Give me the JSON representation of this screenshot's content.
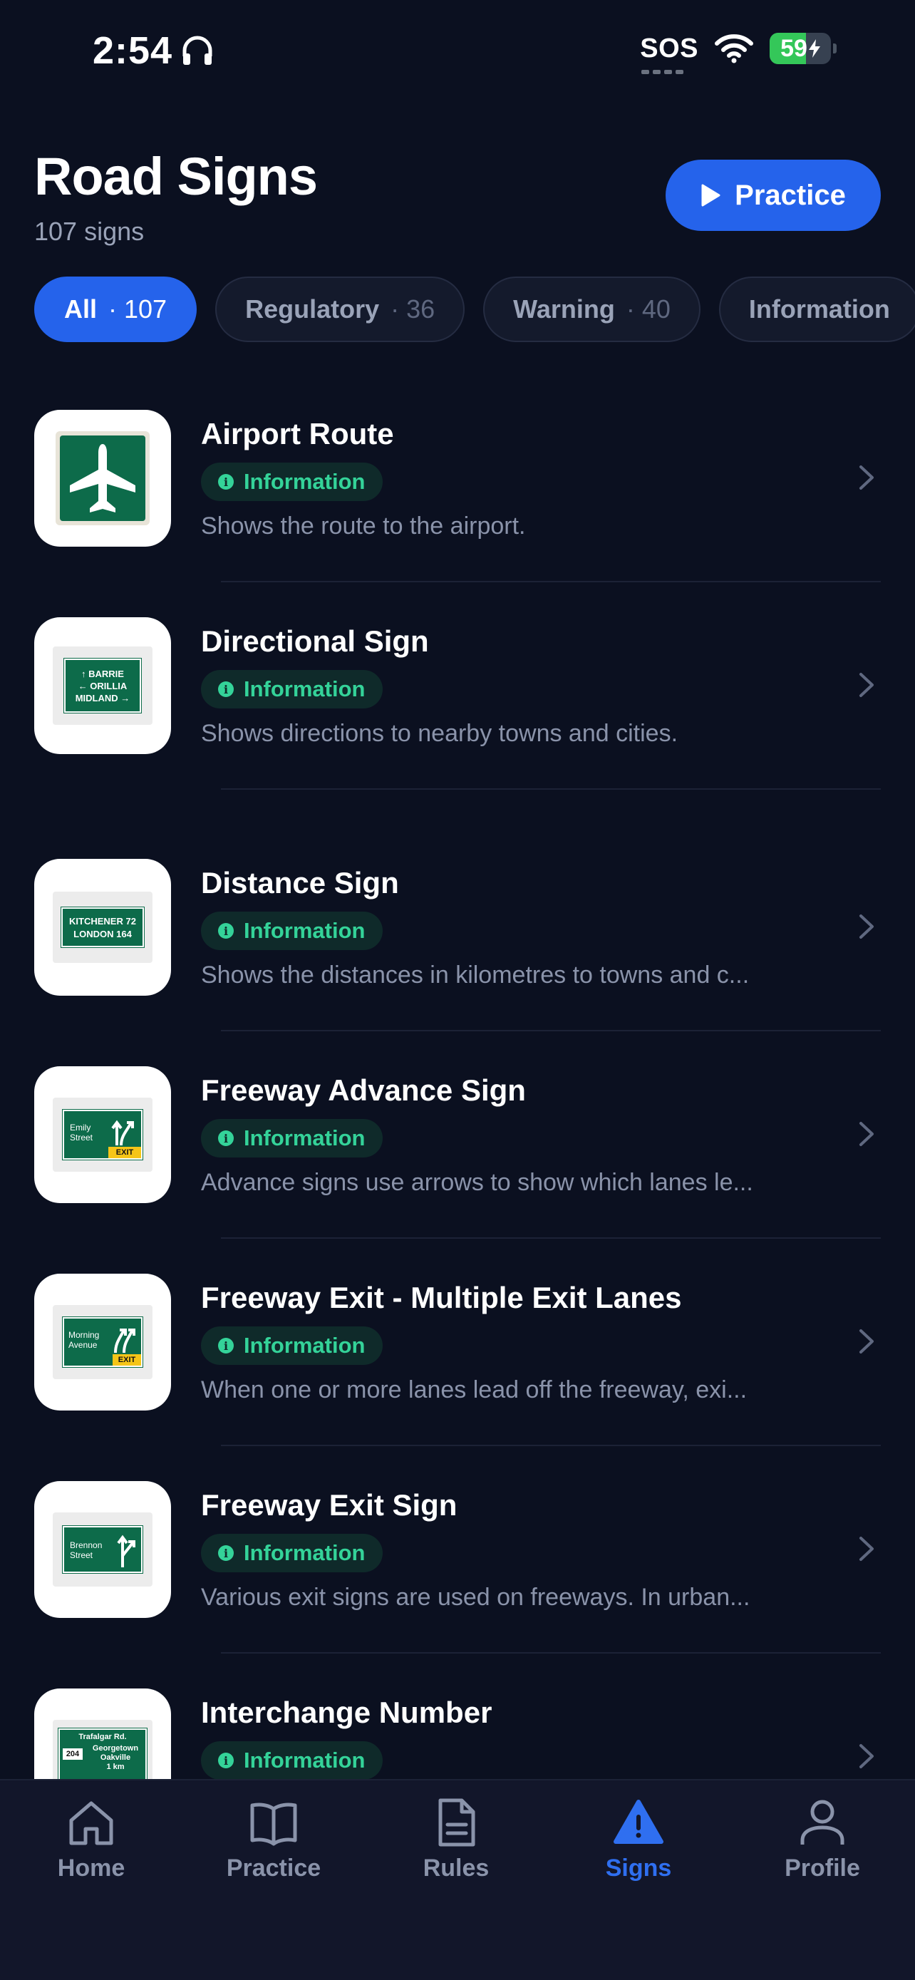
{
  "status_bar": {
    "time": "2:54",
    "sos": "SOS",
    "battery": "59",
    "battery_level_percent": 59
  },
  "header": {
    "title": "Road Signs",
    "subtitle": "107 signs",
    "practice_label": "Practice"
  },
  "filters": [
    {
      "label": "All",
      "count": "· 107",
      "active": true
    },
    {
      "label": "Regulatory",
      "count": "· 36",
      "active": false
    },
    {
      "label": "Warning",
      "count": "· 40",
      "active": false
    },
    {
      "label": "Information",
      "count": "",
      "active": false
    }
  ],
  "signs": [
    {
      "title": "Airport Route",
      "category": "Information",
      "description": "Shows the route to the airport.",
      "icon": "airplane-sign-icon"
    },
    {
      "title": "Directional Sign",
      "category": "Information",
      "description": "Shows directions to nearby towns and cities.",
      "icon": "directional-sign-icon",
      "sign_text": [
        "↑ BARRIE",
        "← ORILLIA",
        "MIDLAND →"
      ]
    },
    {
      "title": "Distance Sign",
      "category": "Information",
      "description": "Shows the distances in kilometres to towns and c...",
      "icon": "distance-sign-icon",
      "sign_text": [
        "KITCHENER  72",
        "LONDON  164"
      ]
    },
    {
      "title": "Freeway Advance Sign",
      "category": "Information",
      "description": "Advance signs use arrows to show which lanes le...",
      "icon": "freeway-advance-sign-icon",
      "sign_text": [
        "Emily",
        "Street",
        "EXIT"
      ]
    },
    {
      "title": "Freeway Exit - Multiple Exit Lanes",
      "category": "Information",
      "description": "When one or more lanes lead off the freeway, exi...",
      "icon": "freeway-exit-multiple-sign-icon",
      "sign_text": [
        "Morning",
        "Avenue",
        "EXIT"
      ]
    },
    {
      "title": "Freeway Exit Sign",
      "category": "Information",
      "description": "Various exit signs are used on freeways. In urban...",
      "icon": "freeway-exit-sign-icon",
      "sign_text": [
        "Brennon",
        "Street"
      ]
    },
    {
      "title": "Interchange Number",
      "category": "Information",
      "description": "",
      "icon": "interchange-number-sign-icon",
      "sign_text": [
        "Trafalgar Rd.",
        "204",
        "Georgetown",
        "Oakville",
        "1 km"
      ]
    }
  ],
  "tabs": [
    {
      "label": "Home",
      "icon": "home-icon",
      "active": false
    },
    {
      "label": "Practice",
      "icon": "book-icon",
      "active": false
    },
    {
      "label": "Rules",
      "icon": "document-icon",
      "active": false
    },
    {
      "label": "Signs",
      "icon": "warning-icon",
      "active": true
    },
    {
      "label": "Profile",
      "icon": "person-icon",
      "active": false
    }
  ],
  "colors": {
    "background": "#0b1020",
    "accent": "#2563eb",
    "info_badge_text": "#34d399",
    "sign_green": "#0d6b4a"
  }
}
